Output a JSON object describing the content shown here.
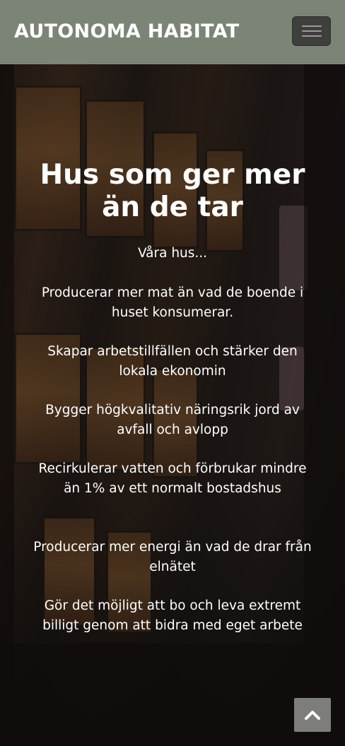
{
  "navbar": {
    "brand": "AUTONOMA HABITAT",
    "menu_icon": "hamburger-menu-icon"
  },
  "hero": {
    "title": "Hus som ger mer än de tar",
    "intro": "Våra hus...",
    "points": [
      "Producerar mer mat än vad de boende i huset konsumerar.",
      "Skapar arbetstillfällen och stärker den lokala ekonomin",
      "Bygger högkvalitativ näringsrik jord av avfall och avlopp",
      "Recirkulerar vatten och förbrukar mindre än 1% av ett normalt bostadshus",
      "Producerar mer energi än vad de drar från elnätet",
      "Gör det möjligt att bo och leva extremt billigt genom att bidra med eget arbete"
    ]
  },
  "scroll_top": {
    "icon": "chevron-up-icon"
  },
  "colors": {
    "navbar_bg": "#7c8476",
    "menu_button_bg": "#3f403d",
    "scroll_top_bg": "#7d7d7b",
    "text": "#ffffff"
  }
}
